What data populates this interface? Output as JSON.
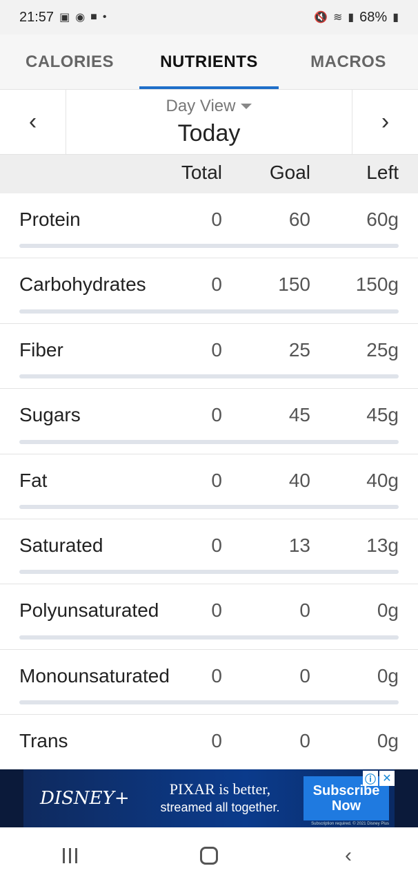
{
  "status_bar": {
    "time": "21:57",
    "battery": "68%"
  },
  "tabs": [
    {
      "label": "CALORIES",
      "active": false
    },
    {
      "label": "NUTRIENTS",
      "active": true
    },
    {
      "label": "MACROS",
      "active": false
    }
  ],
  "date_nav": {
    "view_label": "Day View",
    "date": "Today"
  },
  "columns": {
    "total": "Total",
    "goal": "Goal",
    "left": "Left"
  },
  "nutrients": [
    {
      "name": "Protein",
      "total": "0",
      "goal": "60",
      "left": "60g",
      "progress": 0
    },
    {
      "name": "Carbohydrates",
      "total": "0",
      "goal": "150",
      "left": "150g",
      "progress": 0
    },
    {
      "name": "Fiber",
      "total": "0",
      "goal": "25",
      "left": "25g",
      "progress": 0
    },
    {
      "name": "Sugars",
      "total": "0",
      "goal": "45",
      "left": "45g",
      "progress": 0
    },
    {
      "name": "Fat",
      "total": "0",
      "goal": "40",
      "left": "40g",
      "progress": 0
    },
    {
      "name": "Saturated",
      "total": "0",
      "goal": "13",
      "left": "13g",
      "progress": 0
    },
    {
      "name": "Polyunsaturated",
      "total": "0",
      "goal": "0",
      "left": "0g",
      "progress": 0
    },
    {
      "name": "Monounsaturated",
      "total": "0",
      "goal": "0",
      "left": "0g",
      "progress": 0
    },
    {
      "name": "Trans",
      "total": "0",
      "goal": "0",
      "left": "0g",
      "progress": 0
    }
  ],
  "ad": {
    "brand": "DISNEY+",
    "line1": "PIXAR is better,",
    "line2": "streamed all together.",
    "cta_line1": "Subscribe",
    "cta_line2": "Now",
    "fine_print": "Subscription required. © 2021 Disney Plus"
  },
  "colors": {
    "accent": "#1f6fc9",
    "header_bg": "#eeeeee",
    "ad_bg": "#0b3b8c"
  }
}
